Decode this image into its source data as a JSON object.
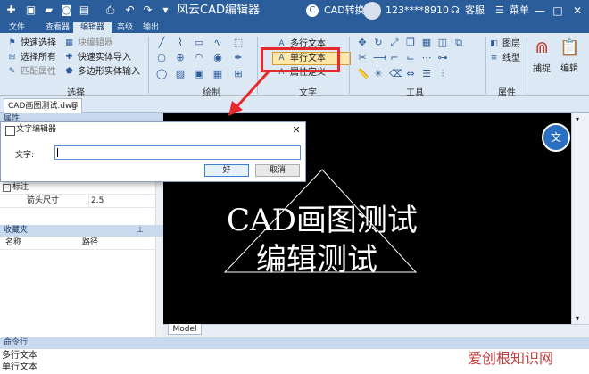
{
  "app": {
    "title": "风云CAD编辑器",
    "converter_label": "CAD转换器",
    "user": "123****8910",
    "service": "客服",
    "menu": "菜单",
    "colors": {
      "title_bar": "#2a5d99",
      "ribbon": "#dde8f5",
      "highlight": "#e8292c",
      "arrow": "#e8292c"
    }
  },
  "quick_access": [
    "plus-icon",
    "folder-icon",
    "save-icon",
    "save-all-icon",
    "print-icon",
    "undo-icon",
    "redo-icon",
    "dropdown-icon"
  ],
  "window_controls": {
    "minimize": "—",
    "maximize": "□",
    "close": "✕"
  },
  "tabs": [
    {
      "label": "文件"
    },
    {
      "label": "查看器"
    },
    {
      "label": "编辑器"
    },
    {
      "label": "高级"
    },
    {
      "label": "输出"
    }
  ],
  "ribbon": {
    "select": {
      "label": "选择",
      "items": [
        "快速选择",
        "选择所有",
        "匹配属性"
      ],
      "items2": [
        "块编辑器",
        "快速实体导入",
        "多边形实体输入"
      ]
    },
    "draw": {
      "label": "绘制"
    },
    "text": {
      "label": "文字",
      "items": [
        "多行文本",
        "单行文本",
        "属性定义"
      ]
    },
    "tools": {
      "label": "工具"
    },
    "props": {
      "label": "属性",
      "items": [
        "图层",
        "线型"
      ]
    },
    "capture": {
      "label": "捕捉"
    },
    "edit": {
      "label": "编辑"
    }
  },
  "document": {
    "tab_name": "CAD画图测试.dwg"
  },
  "left_panel": {
    "properties": {
      "title": "属性",
      "group_marker": "数",
      "section": "标注",
      "row": {
        "name": "箭头尺寸",
        "value": "2.5"
      }
    },
    "favorites": {
      "title": "收藏夹",
      "columns": [
        "名称",
        "路径"
      ]
    }
  },
  "canvas": {
    "line1": "CAD画图测试",
    "line2": "编辑测试",
    "model_tab": "Model"
  },
  "dialog": {
    "title": "文字编辑器",
    "label": "文字:",
    "value": "",
    "ok": "好",
    "cancel": "取消"
  },
  "command": {
    "title": "命令行",
    "lines": [
      "多行文本",
      "单行文本"
    ]
  },
  "watermark": "爱创根知识网"
}
